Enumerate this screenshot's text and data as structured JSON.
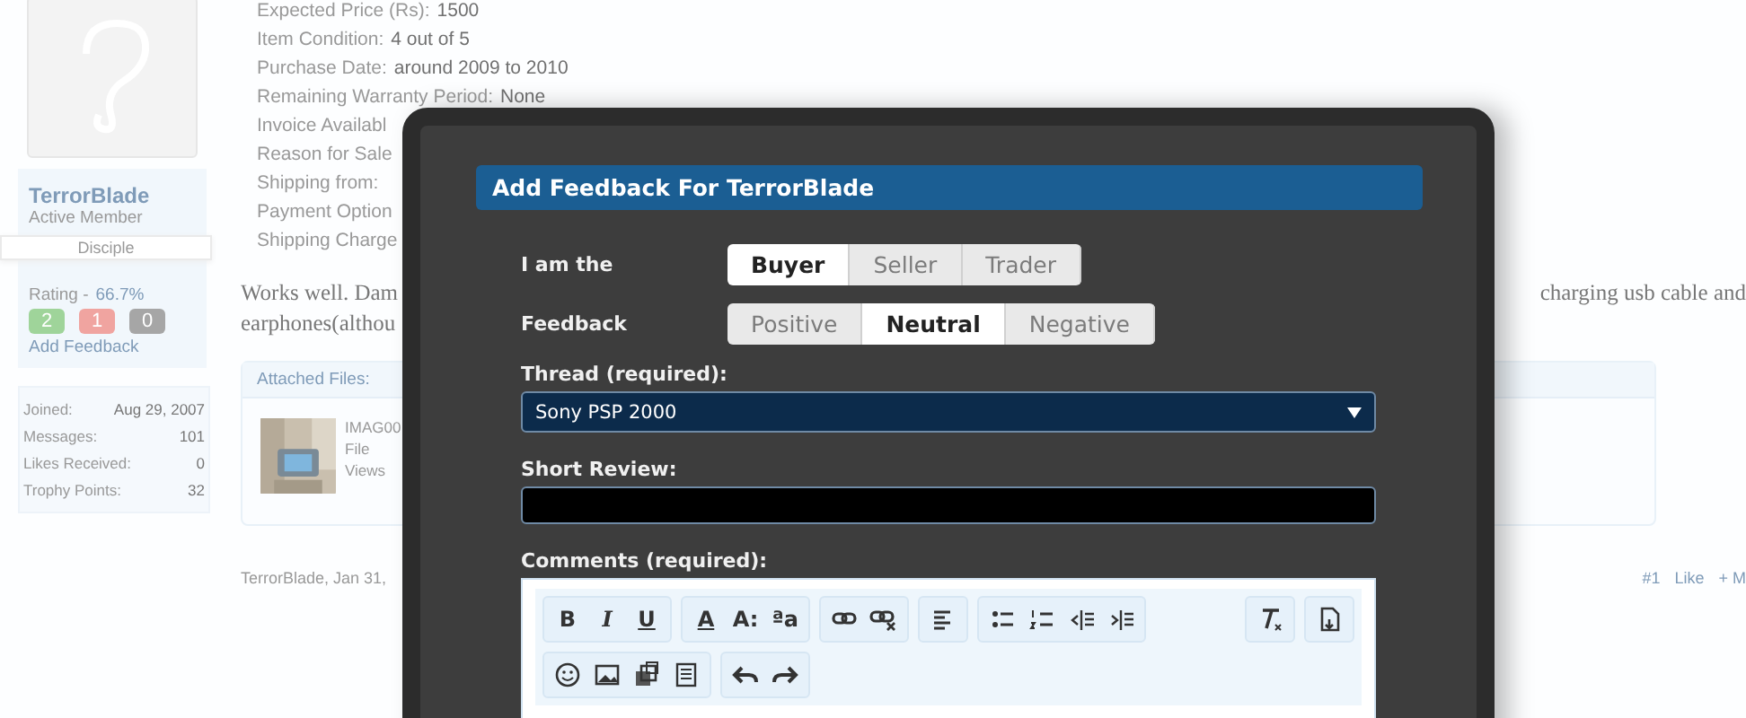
{
  "sidebar": {
    "username": "TerrorBlade",
    "user_title": "Active Member",
    "banner": "Disciple",
    "rating_label": "Rating -",
    "rating_value": "66.7%",
    "feedback_counts": [
      {
        "count": "2",
        "color": "#9fd49a"
      },
      {
        "count": "1",
        "color": "#f0a4a0"
      },
      {
        "count": "0",
        "color": "#a6a6a6"
      }
    ],
    "add_feedback": "Add Feedback",
    "stats": [
      {
        "label": "Joined:",
        "value": "Aug 29, 2007"
      },
      {
        "label": "Messages:",
        "value": "101"
      },
      {
        "label": "Likes Received:",
        "value": "0"
      },
      {
        "label": "Trophy Points:",
        "value": "32"
      }
    ]
  },
  "post": {
    "fields": [
      {
        "label": "Expected Price (Rs):",
        "value": "1500"
      },
      {
        "label": "Item Condition:",
        "value": "4 out of 5"
      },
      {
        "label": "Purchase Date:",
        "value": "around 2009 to 2010"
      },
      {
        "label": "Remaining Warranty Period:",
        "value": "None"
      },
      {
        "label": "Invoice Availabl"
      },
      {
        "label": "Reason for Sale"
      },
      {
        "label": "Shipping from:"
      },
      {
        "label": "Payment Option"
      },
      {
        "label": "Shipping Charge"
      }
    ],
    "message": {
      "left_lines": [
        "Works well. Dam",
        "earphones(althou"
      ],
      "right_lines": [
        "charging usb cable and"
      ]
    },
    "attachments": {
      "title": "Attached Files:",
      "file": {
        "name": "IMAG00",
        "size_label": "File",
        "views_label": "Views"
      }
    },
    "footer": {
      "author_date": "TerrorBlade, Jan 31,",
      "actions": [
        "#1",
        "Like",
        "+ M"
      ]
    }
  },
  "dialog": {
    "title": "Add Feedback For TerrorBlade",
    "role": {
      "label": "I am the",
      "options": [
        {
          "label": "Buyer",
          "selected": true
        },
        {
          "label": "Seller",
          "selected": false
        },
        {
          "label": "Trader",
          "selected": false
        }
      ]
    },
    "feedback": {
      "label": "Feedback",
      "options": [
        {
          "label": "Positive",
          "selected": false
        },
        {
          "label": "Neutral",
          "selected": true
        },
        {
          "label": "Negative",
          "selected": false
        }
      ]
    },
    "thread": {
      "label": "Thread (required):",
      "value": "Sony PSP 2000"
    },
    "short_review": {
      "label": "Short Review:"
    },
    "comments": {
      "label": "Comments (required):",
      "text_buttons": [
        [
          "B",
          "I",
          "U"
        ],
        [
          "A",
          "A:",
          "ªa"
        ]
      ]
    }
  }
}
